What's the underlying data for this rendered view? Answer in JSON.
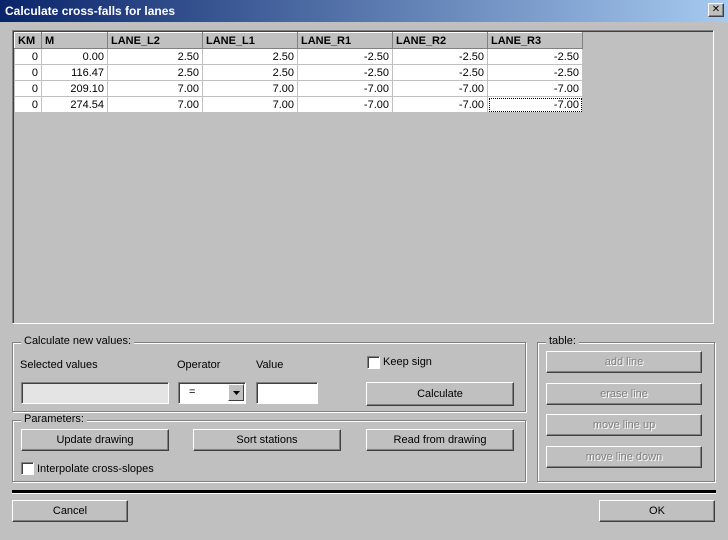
{
  "window": {
    "title": "Calculate cross-falls for lanes",
    "close_glyph": "✕"
  },
  "grid": {
    "columns": [
      "KM",
      "M",
      "LANE_L2",
      "LANE_L1",
      "LANE_R1",
      "LANE_R2",
      "LANE_R3"
    ],
    "rows": [
      [
        "0",
        "0.00",
        "2.50",
        "2.50",
        "-2.50",
        "-2.50",
        "-2.50"
      ],
      [
        "0",
        "116.47",
        "2.50",
        "2.50",
        "-2.50",
        "-2.50",
        "-2.50"
      ],
      [
        "0",
        "209.10",
        "7.00",
        "7.00",
        "-7.00",
        "-7.00",
        "-7.00"
      ],
      [
        "0",
        "274.54",
        "7.00",
        "7.00",
        "-7.00",
        "-7.00",
        "-7.00"
      ]
    ]
  },
  "calc": {
    "group_label": "Calculate new values:",
    "selected_values_label": "Selected values",
    "selected_values_value": "",
    "operator_label": "Operator",
    "operator_value": "=",
    "value_label": "Value",
    "value_value": "",
    "keep_sign_label": "Keep sign",
    "calculate_label": "Calculate"
  },
  "params": {
    "group_label": "Parameters:",
    "update_drawing_label": "Update drawing",
    "sort_stations_label": "Sort stations",
    "read_from_drawing_label": "Read from drawing",
    "interpolate_label": "Interpolate cross-slopes"
  },
  "table_group": {
    "group_label": "table:",
    "add_line_label": "add line",
    "erase_line_label": "erase line",
    "move_line_up_label": "move line up",
    "move_line_down_label": "move line down"
  },
  "footer": {
    "cancel_label": "Cancel",
    "ok_label": "OK"
  }
}
